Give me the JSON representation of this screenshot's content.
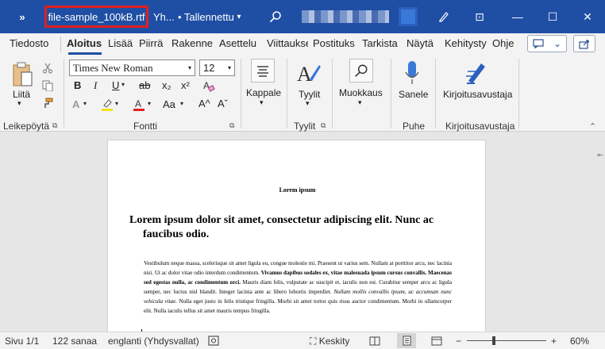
{
  "titlebar": {
    "qa_more": "»",
    "filename": "file-sample_100kB.rtf",
    "group_trunc": "Yh...",
    "saved_status": "• Tallennettu",
    "saved_dd": "▾",
    "minimize": "—",
    "restore": "☐",
    "close": "✕",
    "ribbon_display": "⊡"
  },
  "tabs": [
    "Tiedosto",
    "Aloitus",
    "Lisää",
    "Piirrä",
    "Rakenne",
    "Asettelu",
    "Viittaukset",
    "Postituks",
    "Tarkista",
    "Näytä",
    "Kehitysty",
    "Ohje"
  ],
  "ribbon": {
    "clipboard": {
      "paste": "Liitä",
      "group": "Leikepöytä"
    },
    "font": {
      "family": "Times New Roman",
      "size": "12",
      "dd": "▾",
      "bold": "B",
      "italic": "I",
      "underline": "U",
      "strike": "ab",
      "sub": "x₂",
      "sup": "x²",
      "grow": "A^",
      "shrink": "Aˇ",
      "case": "Aa",
      "group": "Fontti"
    },
    "paragraph": {
      "label": "Kappale"
    },
    "styles": {
      "label": "Tyylit",
      "group": "Tyylit"
    },
    "editing": {
      "label": "Muokkaus"
    },
    "voice": {
      "label": "Sanele",
      "group": "Puhe"
    },
    "editor": {
      "label": "Kirjoitusavustaja",
      "group": "Kirjoitusavustaja"
    }
  },
  "document": {
    "small_title": "Lorem ipsum",
    "heading_l1": "Lorem ipsum dolor sit amet, consectetur adipiscing elit. Nunc ac",
    "heading_l2": "faucibus odio.",
    "body_a": "Vestibulum neque massa, scelerisque sit amet ligula eu, congue molestie mi. Praesent ut varius sem. Nullam at porttitor arcu, nec lacinia nisi. Ut ac dolor vitae odio interdum condimentum. ",
    "body_b": "Vivamus dapibus sodales ex, vitae malesuada ipsum cursus convallis. Maecenas sed egestas nulla, ac condimentum orci.",
    "body_c": " Mauris diam felis, vulputate ac suscipit et, iaculis non est. Curabitur semper arcu ac ligula semper, nec luctus nisl blandit. Integer lacinia ante ac libero lobortis imperdiet. ",
    "body_d": "Nullam mollis convallis ipsum, ac accumsan nunc vehicula vitae.",
    "body_e": " Nulla eget justo in felis tristique fringilla. Morbi sit amet tortor quis risus auctor condimentum. Morbi in ullamcorper elit. Nulla iaculis tellus sit amet mauris tempus fringilla."
  },
  "statusbar": {
    "page": "Sivu 1/1",
    "words": "122 sanaa",
    "language": "englanti (Yhdysvallat)",
    "focus": "Keskity",
    "zoom": "60%",
    "zoom_minus": "−",
    "zoom_plus": "+"
  },
  "colors": {
    "accent": "#1f4fa4",
    "highlight_box": "#e02020"
  }
}
